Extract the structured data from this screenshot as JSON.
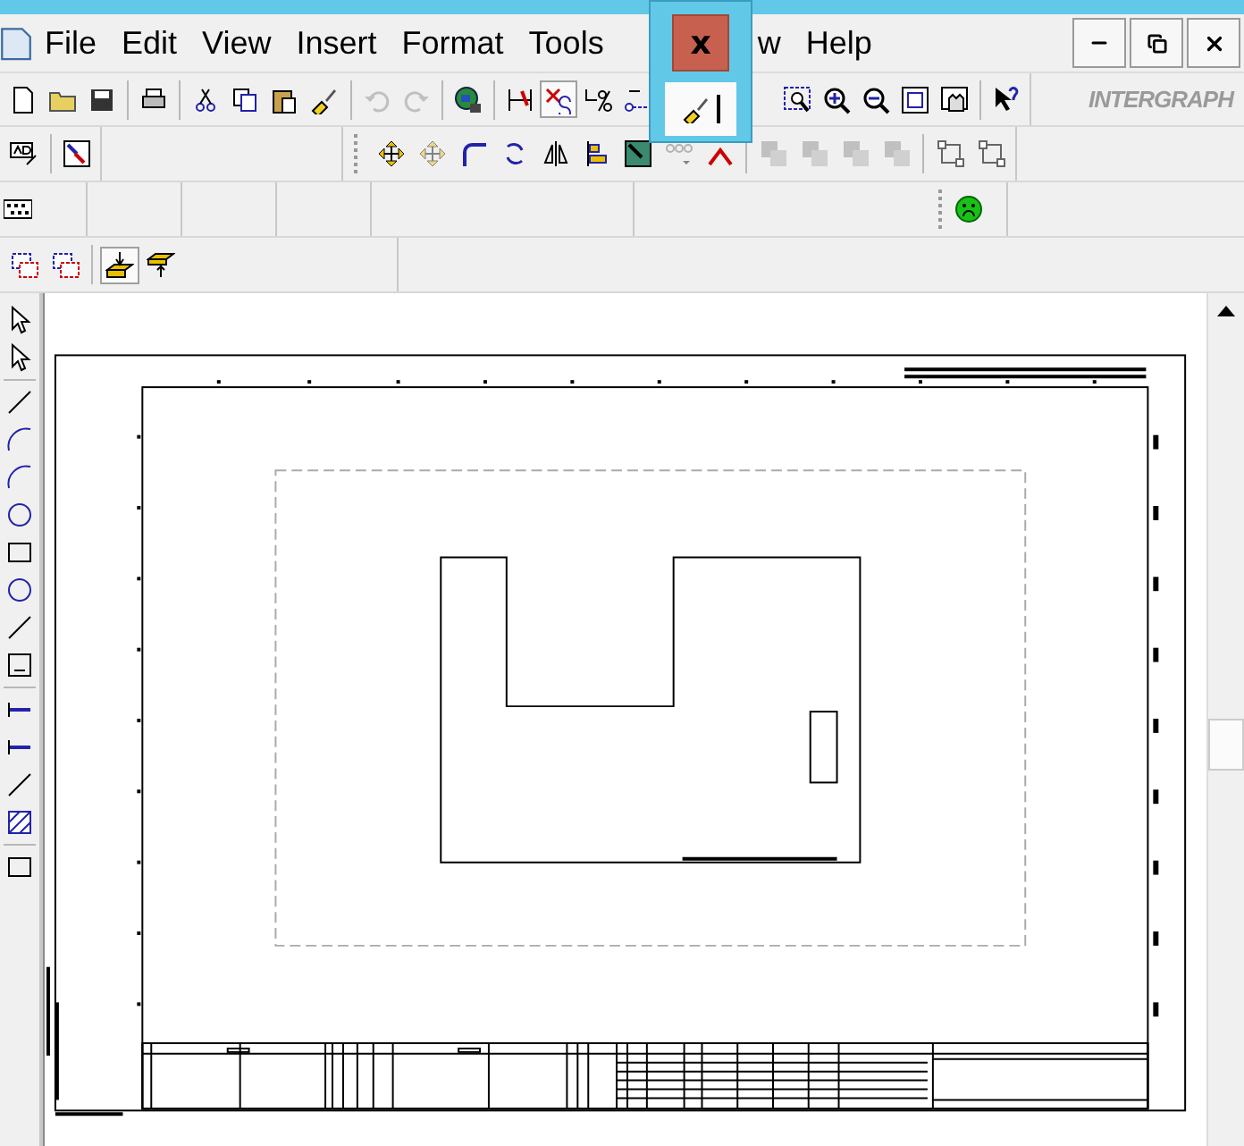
{
  "menu": [
    {
      "label": "File"
    },
    {
      "label": "Edit"
    },
    {
      "label": "View"
    },
    {
      "label": "Insert"
    },
    {
      "label": "Format"
    },
    {
      "label": "Tools"
    },
    {
      "label": "w"
    },
    {
      "label": "Help"
    }
  ],
  "logo": "INTERGRAPH",
  "popup": {
    "close_label": "x"
  },
  "main_toolbar": [
    {
      "disabled": false,
      "pressed": false
    },
    {
      "disabled": false,
      "pressed": false
    },
    {
      "disabled": false,
      "pressed": false
    },
    {
      "disabled": false,
      "pressed": false
    },
    {
      "disabled": false,
      "pressed": false
    },
    {
      "disabled": false,
      "pressed": false
    },
    {
      "disabled": false,
      "pressed": false
    },
    {
      "disabled": false,
      "pressed": false
    },
    {
      "disabled": true,
      "pressed": false
    },
    {
      "disabled": true,
      "pressed": false
    },
    {
      "disabled": false,
      "pressed": false
    },
    {
      "disabled": false,
      "pressed": false
    },
    {
      "disabled": false,
      "pressed": true
    },
    {
      "disabled": false,
      "pressed": false
    },
    {
      "disabled": false,
      "pressed": false
    }
  ],
  "zoom_toolbar": [
    {
      "disabled": false
    },
    {
      "disabled": false
    },
    {
      "disabled": false
    },
    {
      "disabled": false
    },
    {
      "disabled": false
    },
    {
      "disabled": false
    }
  ],
  "modify_toolbar": [
    {
      "disabled": false
    },
    {
      "disabled": true
    },
    {
      "disabled": false
    },
    {
      "disabled": false
    },
    {
      "disabled": false
    },
    {
      "disabled": false
    },
    {
      "disabled": false
    },
    {
      "disabled": true
    },
    {
      "disabled": false
    },
    {
      "disabled": true
    },
    {
      "disabled": true
    },
    {
      "disabled": true
    },
    {
      "disabled": true
    },
    {
      "disabled": false
    },
    {
      "disabled": false
    }
  ],
  "layer_toolbar": [
    {
      "pressed": false
    },
    {
      "pressed": false
    },
    {
      "pressed": true
    },
    {
      "pressed": false
    }
  ]
}
